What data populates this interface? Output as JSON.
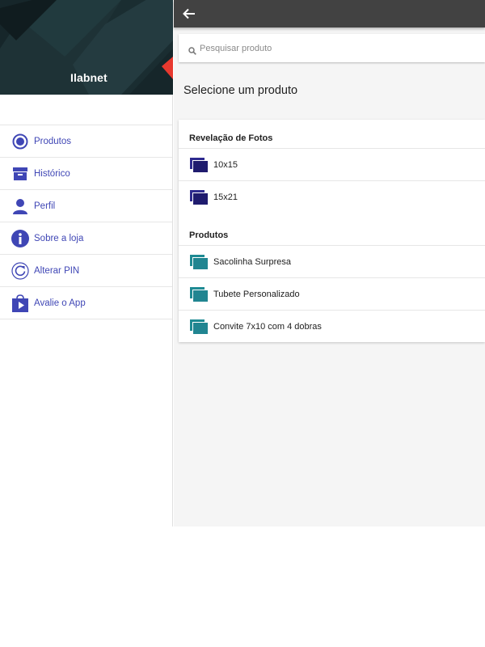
{
  "drawer": {
    "app_name": "Ilabnet",
    "menu": [
      {
        "label": "Produtos",
        "icon": "radio-selected-icon"
      },
      {
        "label": "Histórico",
        "icon": "archive-icon"
      },
      {
        "label": "Perfil",
        "icon": "person-icon"
      },
      {
        "label": "Sobre a loja",
        "icon": "info-icon"
      },
      {
        "label": "Alterar PIN",
        "icon": "refresh-icon"
      },
      {
        "label": "Avalie o App",
        "icon": "play-store-icon"
      }
    ]
  },
  "appbar": {
    "back_icon": "arrow-back-icon"
  },
  "search": {
    "placeholder": "Pesquisar produto",
    "value": ""
  },
  "page_title": "Selecione um produto",
  "sections": [
    {
      "title": "Revelação de Fotos",
      "items": [
        "10x15",
        "15x21"
      ],
      "icon_color": "#1f1b6e"
    },
    {
      "title": "Produtos",
      "items": [
        "Sacolinha Surpresa",
        "Tubete Personalizado",
        "Convite 7x10 com 4 dobras"
      ],
      "icon_color": "#218591"
    }
  ],
  "colors": {
    "accent": "#3f46b5",
    "appbar": "#424242",
    "background": "#f5f5f5"
  }
}
